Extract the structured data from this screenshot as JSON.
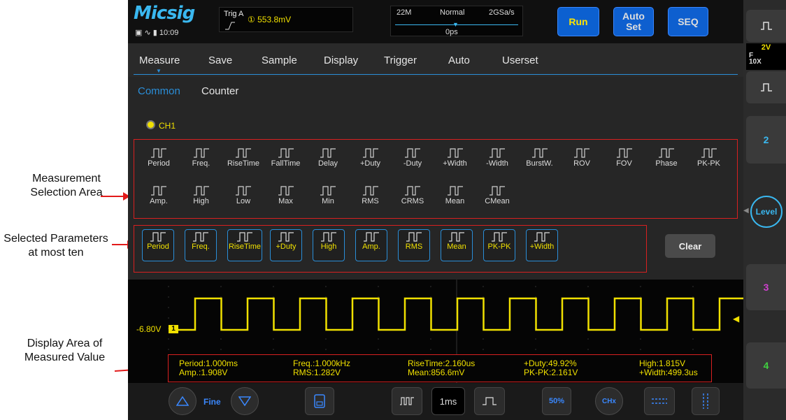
{
  "annotations": {
    "measurement_selection": "Measurement\nSelection Area",
    "selected_parameters": "Selected Parameters\nat most ten",
    "display_area": "Display Area of\nMeasured Value"
  },
  "header": {
    "logo": "Micsig",
    "time": "10:09",
    "trigger_label": "Trig A",
    "trigger_value": "① 553.8mV",
    "memory_depth": "22M",
    "acq_mode": "Normal",
    "sample_rate": "2GSa/s",
    "time_offset": "0ps",
    "run_label": "Run",
    "autoset_label": "Auto\nSet",
    "seq_label": "SEQ"
  },
  "right_panel": {
    "ch1_volt": "2V",
    "ch1_coupling": "F",
    "ch1_probe": "10X",
    "ch2_label": "2",
    "level_label": "Level",
    "ch3_label": "3",
    "ch4_label": "4"
  },
  "menu": {
    "items": [
      "Measure",
      "Save",
      "Sample",
      "Display",
      "Trigger",
      "Auto",
      "Userset"
    ],
    "active": "Measure"
  },
  "submenu": {
    "items": [
      "Common",
      "Counter"
    ],
    "active": "Common"
  },
  "channel_label": "CH1",
  "measurement_items_row1": [
    "Period",
    "Freq.",
    "RiseTime",
    "FallTime",
    "Delay",
    "+Duty",
    "-Duty",
    "+Width",
    "-Width",
    "BurstW.",
    "ROV",
    "FOV",
    "Phase",
    "PK-PK"
  ],
  "measurement_items_row2": [
    "Amp.",
    "High",
    "Low",
    "Max",
    "Min",
    "RMS",
    "CRMS",
    "Mean",
    "CMean"
  ],
  "selected_params": [
    "Period",
    "Freq.",
    "RiseTime",
    "+Duty",
    "High",
    "Amp.",
    "RMS",
    "Mean",
    "PK-PK",
    "+Width"
  ],
  "clear_label": "Clear",
  "waveform": {
    "offset_label": "-6.80V",
    "channel_marker": "1",
    "color": "#f0e000"
  },
  "readouts": [
    [
      "Period:1.000ms",
      "Amp.:1.908V"
    ],
    [
      "Freq.:1.000kHz",
      "RMS:1.282V"
    ],
    [
      "RiseTime:2.160us",
      "Mean:856.6mV"
    ],
    [
      "+Duty:49.92%",
      "PK-PK:2.161V"
    ],
    [
      "High:1.815V",
      "+Width:499.3us"
    ]
  ],
  "bottom": {
    "fine_label": "Fine",
    "timebase": "1ms",
    "pct_label": "50%",
    "chx_label": "CHx"
  }
}
